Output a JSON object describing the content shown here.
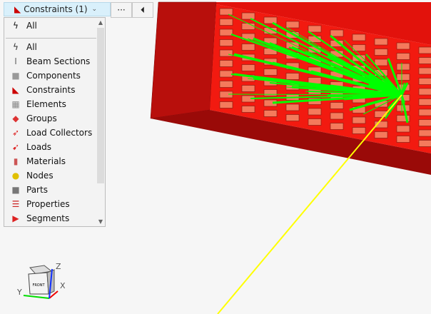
{
  "toolbar": {
    "selector_label": "Constraints (1)",
    "more_label": "···",
    "collapse_label": "⏴"
  },
  "panel": {
    "top_item": "All",
    "items": [
      {
        "label": "All",
        "icon": "lightning-icon"
      },
      {
        "label": "Beam Sections",
        "icon": "beam-section-icon"
      },
      {
        "label": "Components",
        "icon": "component-icon"
      },
      {
        "label": "Constraints",
        "icon": "constraint-icon"
      },
      {
        "label": "Elements",
        "icon": "element-icon"
      },
      {
        "label": "Groups",
        "icon": "group-icon"
      },
      {
        "label": "Load Collectors",
        "icon": "load-collector-icon"
      },
      {
        "label": "Loads",
        "icon": "load-icon"
      },
      {
        "label": "Materials",
        "icon": "material-icon"
      },
      {
        "label": "Nodes",
        "icon": "node-icon"
      },
      {
        "label": "Parts",
        "icon": "part-icon"
      },
      {
        "label": "Properties",
        "icon": "property-icon"
      },
      {
        "label": "Segments",
        "icon": "segment-icon"
      }
    ]
  },
  "view_cube": {
    "face_label": "FRONT",
    "axes": {
      "x": "X",
      "y": "Y",
      "z": "Z"
    }
  },
  "colors": {
    "model_red": "#e8120c",
    "constraint_green": "#00ff00",
    "highlight_yellow": "#ffff00"
  }
}
